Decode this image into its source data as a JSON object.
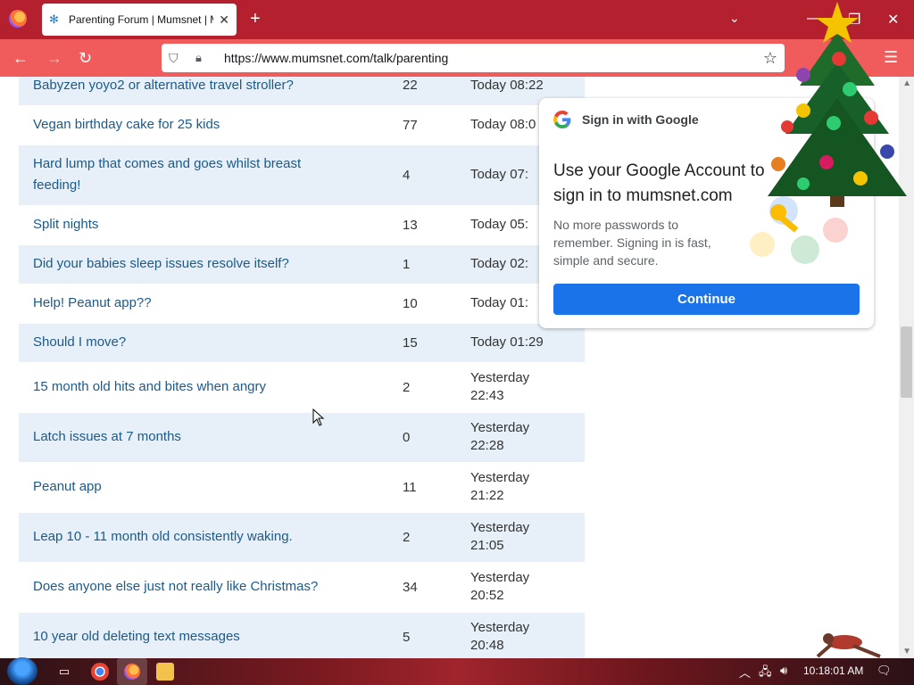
{
  "browser": {
    "tab_title": "Parenting Forum | Mumsnet | M",
    "url": "https://www.mumsnet.com/talk/parenting"
  },
  "threads": [
    {
      "title": "Babyzen yoyo2 or alternative travel stroller?",
      "count": "22",
      "last_line1": "Today 08:22",
      "last_line2": ""
    },
    {
      "title": "Vegan birthday cake for 25 kids",
      "count": "77",
      "last_line1": "Today 08:0",
      "last_line2": ""
    },
    {
      "title": "Hard lump that comes and goes whilst breast feeding!",
      "count": "4",
      "last_line1": "Today 07:",
      "last_line2": ""
    },
    {
      "title": "Split nights",
      "count": "13",
      "last_line1": "Today 05:",
      "last_line2": ""
    },
    {
      "title": "Did your babies sleep issues resolve itself?",
      "count": "1",
      "last_line1": "Today 02:",
      "last_line2": ""
    },
    {
      "title": "Help! Peanut app??",
      "count": "10",
      "last_line1": "Today 01:",
      "last_line2": ""
    },
    {
      "title": "Should I move?",
      "count": "15",
      "last_line1": "Today 01:29",
      "last_line2": ""
    },
    {
      "title": "15 month old hits and bites when angry",
      "count": "2",
      "last_line1": "Yesterday",
      "last_line2": "22:43"
    },
    {
      "title": "Latch issues at 7 months",
      "count": "0",
      "last_line1": "Yesterday",
      "last_line2": "22:28"
    },
    {
      "title": "Peanut app",
      "count": "11",
      "last_line1": "Yesterday",
      "last_line2": "21:22"
    },
    {
      "title": "Leap 10 - 11 month old consistently waking.",
      "count": "2",
      "last_line1": "Yesterday",
      "last_line2": "21:05"
    },
    {
      "title": "Does anyone else just not really like Christmas?",
      "count": "34",
      "last_line1": "Yesterday",
      "last_line2": "20:52"
    },
    {
      "title": "10 year old deleting text messages",
      "count": "5",
      "last_line1": "Yesterday",
      "last_line2": "20:48"
    }
  ],
  "google_signin": {
    "header": "Sign in with Google",
    "title": "Use your Google Account to sign in to mumsnet.com",
    "body": "No more passwords to remember. Signing in is fast, simple and secure.",
    "button": "Continue"
  },
  "taskbar": {
    "clock": "10:18:01 AM"
  },
  "colors": {
    "tabbar": "#b4202e",
    "navbar": "#f05b5b",
    "link": "#1c5a8a",
    "row_shade": "#e7f0f8",
    "google_blue": "#1a73e8"
  },
  "icons": [
    "firefox-icon",
    "tab-favicon",
    "close-tab-icon",
    "new-tab-icon",
    "back-icon",
    "forward-icon",
    "reload-icon",
    "shield-icon",
    "lock-icon",
    "bookmark-star-icon",
    "menu-icon",
    "google-logo",
    "christmas-tree",
    "start-orb",
    "task-view-icon",
    "chrome-icon",
    "firefox-taskbar-icon",
    "file-explorer-icon"
  ]
}
